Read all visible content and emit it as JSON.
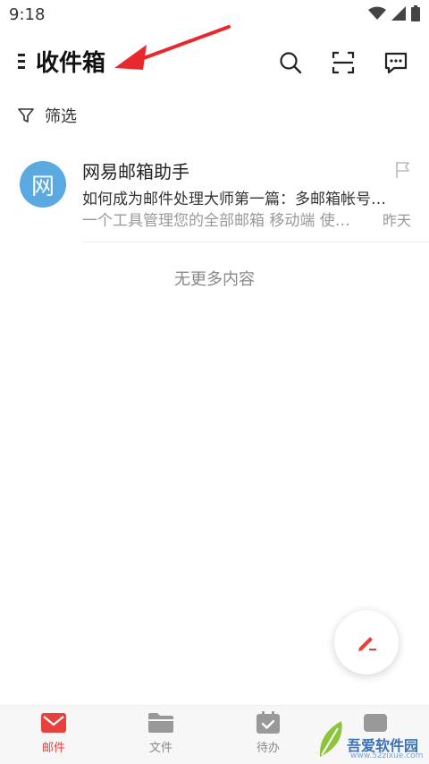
{
  "status": {
    "time": "9:18"
  },
  "header": {
    "title": "收件箱"
  },
  "filter": {
    "label": "筛选"
  },
  "mails": [
    {
      "avatar_char": "网",
      "sender": "网易邮箱助手",
      "subject": "如何成为邮件处理大师第一篇：多邮箱帐号…",
      "preview": "一个工具管理您的全部邮箱 移动端 使…",
      "date": "昨天"
    }
  ],
  "list_end": "无更多内容",
  "tabs": [
    {
      "label": "邮件",
      "active": true
    },
    {
      "label": "文件",
      "active": false
    },
    {
      "label": "待办",
      "active": false
    }
  ],
  "watermark": {
    "text": "吾爱软件园",
    "url": "www.52zixue.com"
  },
  "colors": {
    "accent": "#e8403c",
    "avatar": "#5aa9e0"
  }
}
